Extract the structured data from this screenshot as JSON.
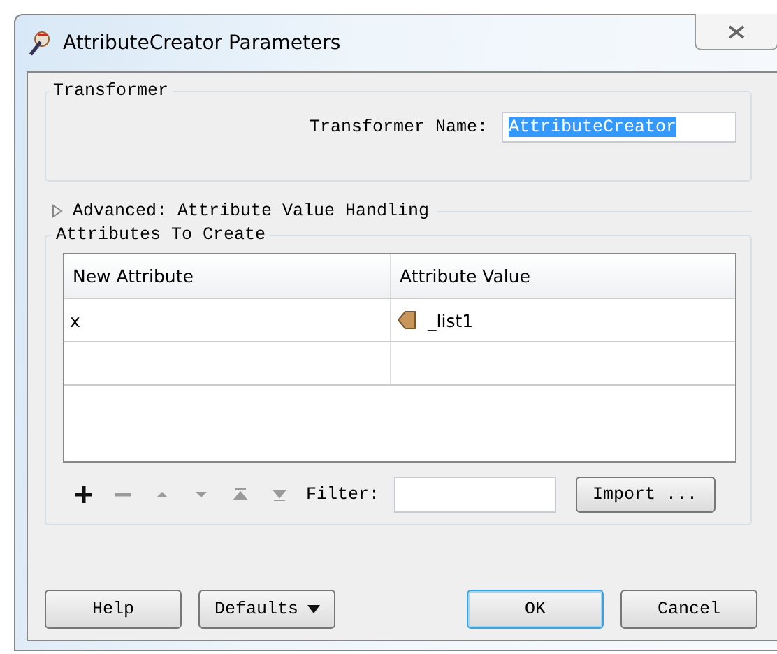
{
  "window": {
    "title": "AttributeCreator Parameters"
  },
  "transformer": {
    "legend": "Transformer",
    "name_label": "Transformer Name:",
    "name_value": "AttributeCreator",
    "name_selected": true
  },
  "advanced": {
    "label": "Advanced: Attribute Value Handling",
    "expanded": false
  },
  "attributes": {
    "legend": "Attributes To Create",
    "table": {
      "columns": [
        "New Attribute",
        "Attribute Value"
      ],
      "rows": [
        {
          "name": "x",
          "value": "_list1",
          "kind": "attribute"
        },
        {
          "kind": "empty"
        }
      ]
    },
    "tools": [
      {
        "kind": "add",
        "disabled": false
      },
      {
        "kind": "remove",
        "disabled": true
      },
      {
        "kind": "up",
        "disabled": true
      },
      {
        "kind": "down",
        "disabled": true
      },
      {
        "kind": "top",
        "disabled": true
      },
      {
        "kind": "bottom",
        "disabled": true
      }
    ],
    "filter_label": "Filter:",
    "import_button": "Import ..."
  },
  "buttons": {
    "help": "Help",
    "defaults": "Defaults",
    "ok": "OK",
    "cancel": "Cancel"
  }
}
